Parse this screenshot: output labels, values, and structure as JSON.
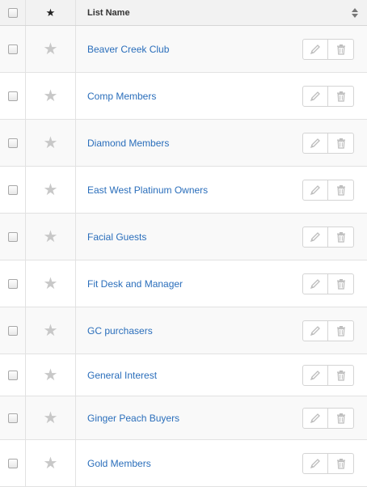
{
  "header": {
    "list_name": "List Name"
  },
  "rows": [
    {
      "name": "Beaver Creek Club"
    },
    {
      "name": "Comp Members"
    },
    {
      "name": "Diamond Members"
    },
    {
      "name": "East West Platinum Owners"
    },
    {
      "name": "Facial Guests"
    },
    {
      "name": "Fit Desk and Manager"
    },
    {
      "name": "GC purchasers"
    },
    {
      "name": "General Interest"
    },
    {
      "name": "Ginger Peach Buyers"
    },
    {
      "name": "Gold Members"
    }
  ],
  "icons": {
    "favorite": "star-icon",
    "edit": "pencil-icon",
    "delete": "trash-icon",
    "sort": "sort-icon"
  },
  "colors": {
    "link": "#2a6ebb",
    "star_inactive": "#c8c8c8",
    "header_bg": "#f2f2f2"
  }
}
